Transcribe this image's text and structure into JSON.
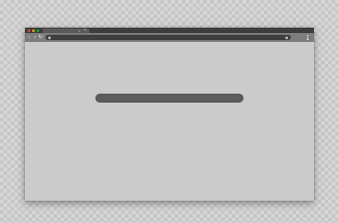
{
  "window": {
    "tab_close": "×",
    "new_tab": "+",
    "traffic_lights": [
      "#e0443e",
      "#dea123",
      "#1aab29"
    ]
  },
  "toolbar": {
    "back_icon": "‹",
    "forward_icon": "›",
    "reload_icon": "↻"
  },
  "icons": [
    "close-icon",
    "plus-icon",
    "back-icon",
    "forward-icon",
    "reload-icon",
    "menu-icon"
  ],
  "colors": {
    "title_bar": "#3d3d3d",
    "toolbar": "#7d7d7d",
    "address_bar": "#3f3f3f",
    "content": "#cbcbcb",
    "placeholder_bar": "#5c5c5c"
  }
}
